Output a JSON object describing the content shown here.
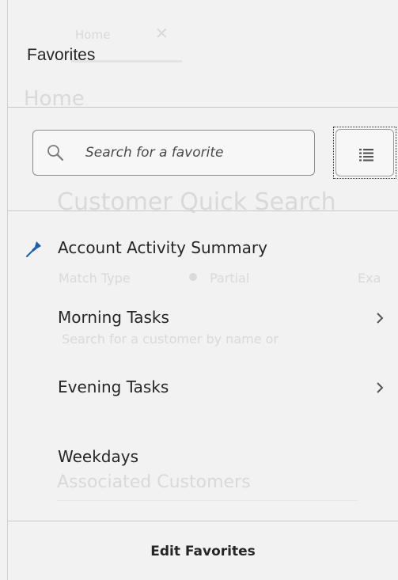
{
  "background": {
    "tab_label": "Home",
    "tab_close": "✕",
    "page_title": "Home",
    "section_title": "Customer Quick Search",
    "match_type_label": "Match Type",
    "match_option_partial": "Partial",
    "match_option_exact": "Exa",
    "search_hint": "Search for a customer by name or",
    "associated_title": "Associated Customers"
  },
  "favorites": {
    "title": "Favorites",
    "search": {
      "placeholder": "Search for a favorite",
      "icon": "search-icon"
    },
    "list_view_icon": "list-icon",
    "items": [
      {
        "label": "Account Activity Summary",
        "pinned": true,
        "has_submenu": false
      },
      {
        "label": "Morning Tasks",
        "pinned": false,
        "has_submenu": true
      },
      {
        "label": "Evening Tasks",
        "pinned": false,
        "has_submenu": true
      },
      {
        "label": "Weekdays",
        "pinned": false,
        "has_submenu": false
      }
    ],
    "footer_action": "Edit Favorites",
    "colors": {
      "pin": "#1a5fb4",
      "text": "#262626",
      "panel_bg": "#f2f2f2"
    }
  }
}
